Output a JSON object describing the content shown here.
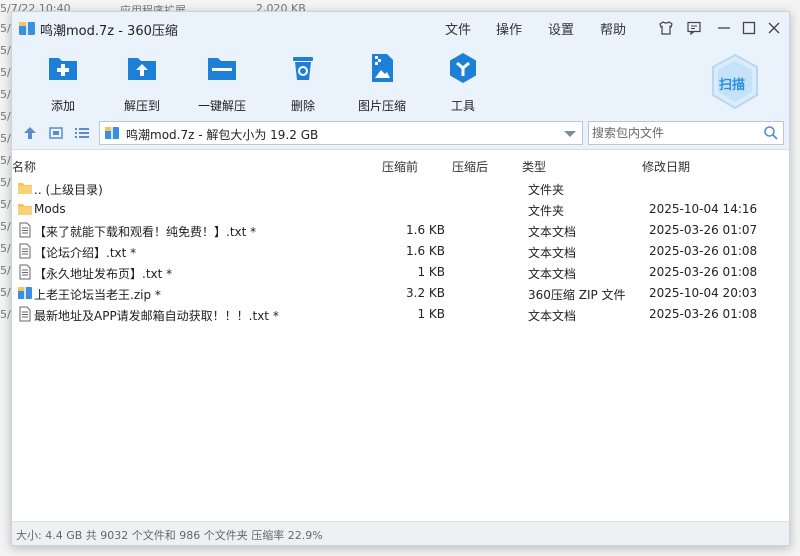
{
  "background": {
    "rows": [
      {
        "date": "5/7/22 10:40",
        "type": "应用程序扩展",
        "size": "2,020 KB"
      }
    ],
    "edge_chars": [
      "5/",
      "5/",
      "5/",
      "5/",
      "5/",
      "5/",
      "5/",
      "5/",
      "5/",
      "5/",
      "5/",
      "5/",
      "5/",
      "5/"
    ]
  },
  "window": {
    "title": "鸣潮mod.7z - 360压缩",
    "menu": [
      "文件",
      "操作",
      "设置",
      "帮助"
    ]
  },
  "toolbar": {
    "tools": [
      {
        "label": "添加",
        "icon": "add-folder-icon"
      },
      {
        "label": "解压到",
        "icon": "extract-to-icon"
      },
      {
        "label": "一键解压",
        "icon": "one-click-extract-icon"
      },
      {
        "label": "删除",
        "icon": "delete-icon"
      },
      {
        "label": "图片压缩",
        "icon": "image-compress-icon"
      },
      {
        "label": "工具",
        "icon": "tools-icon"
      }
    ],
    "scan_label": "扫描"
  },
  "address": {
    "path": "鸣潮mod.7z - 解包大小为 19.2 GB",
    "search_placeholder": "搜索包内文件"
  },
  "columns": {
    "name": "名称",
    "compressed": "压缩前",
    "uncompressed": "压缩后",
    "type": "类型",
    "modified": "修改日期"
  },
  "files": [
    {
      "icon": "folder-icon",
      "name": ".. (上级目录)",
      "size": "",
      "type": "文件夹",
      "date": ""
    },
    {
      "icon": "folder-icon",
      "name": "Mods",
      "size": "",
      "type": "文件夹",
      "date": "2025-10-04 14:16"
    },
    {
      "icon": "text-file-icon",
      "name": "【来了就能下载和观看！纯免费！】.txt *",
      "size": "1.6 KB",
      "type": "文本文档",
      "date": "2025-03-26 01:07"
    },
    {
      "icon": "text-file-icon",
      "name": "【论坛介绍】.txt *",
      "size": "1.6 KB",
      "type": "文本文档",
      "date": "2025-03-26 01:08"
    },
    {
      "icon": "text-file-icon",
      "name": "【永久地址发布页】.txt *",
      "size": "1 KB",
      "type": "文本文档",
      "date": "2025-03-26 01:08"
    },
    {
      "icon": "zip-file-icon",
      "name": "上老王论坛当老王.zip *",
      "size": "3.2 KB",
      "type": "360压缩 ZIP 文件",
      "date": "2025-10-04 20:03"
    },
    {
      "icon": "text-file-icon",
      "name": "最新地址及APP请发邮箱自动获取！！！.txt *",
      "size": "1 KB",
      "type": "文本文档",
      "date": "2025-03-26 01:08"
    }
  ],
  "status": "大小: 4.4 GB 共 9032 个文件和 986 个文件夹 压缩率 22.9%",
  "colors": {
    "accent": "#1e7fd6",
    "toolbar_bg": "#eaf2fb",
    "folder": "#f5c55b"
  }
}
